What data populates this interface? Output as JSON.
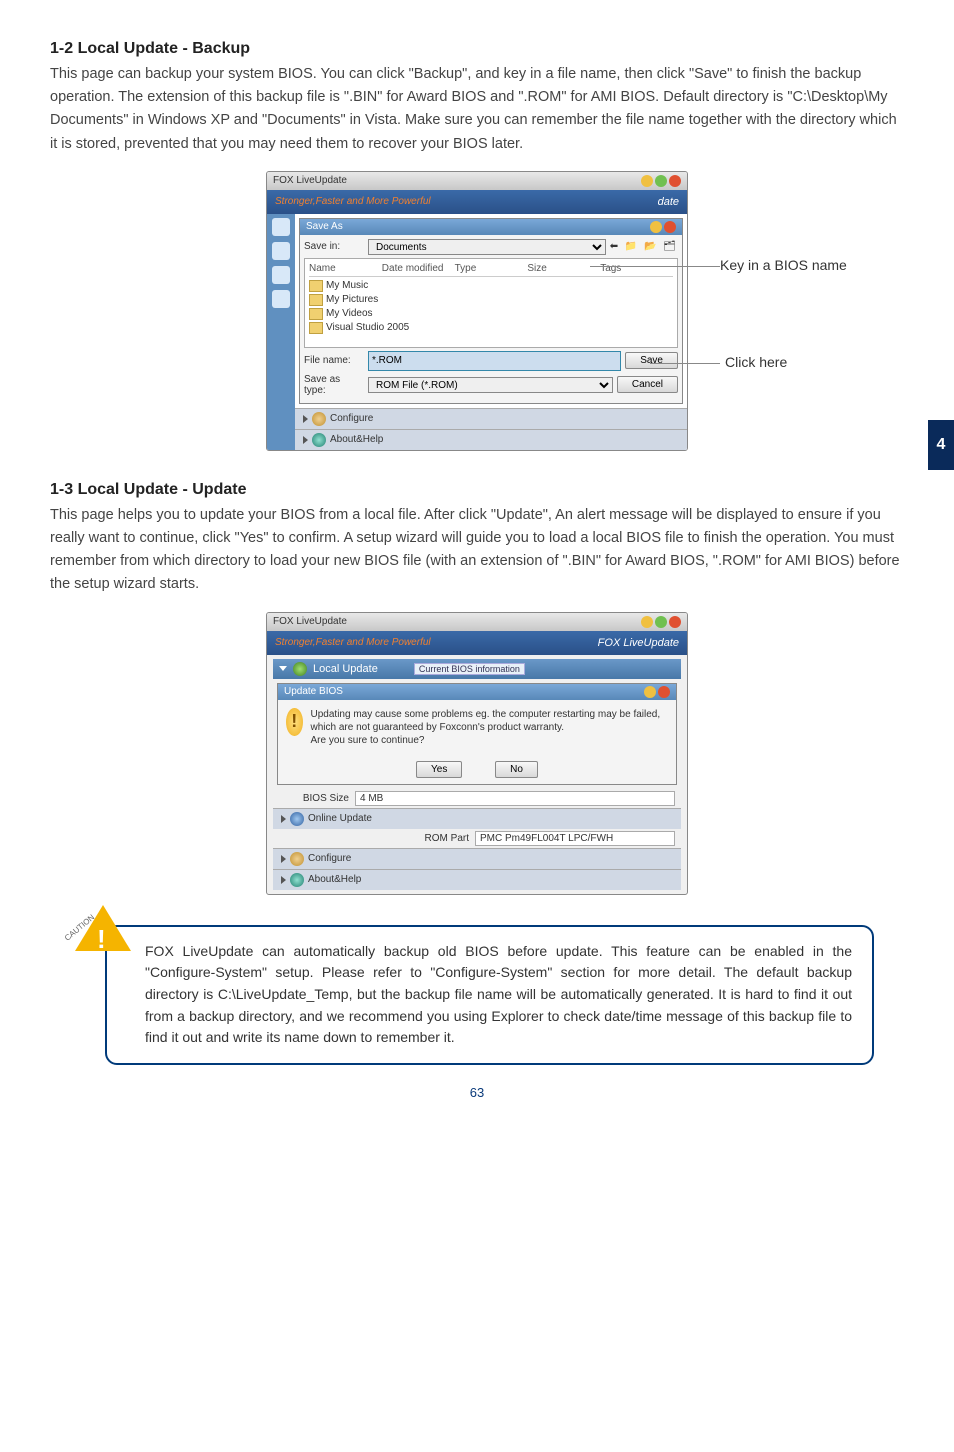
{
  "section12": {
    "heading": "1-2 Local Update - Backup",
    "body": "This page can backup your system BIOS. You can click \"Backup\", and key in a file name, then click \"Save\" to finish the backup operation. The extension of this backup file is \".BIN\" for Award BIOS and \".ROM\" for AMI BIOS. Default directory is \"C:\\Desktop\\My Documents\" in Windows XP and \"Documents\" in Vista. Make sure you can remember the file name together with the directory which it is stored, prevented that you may need them to recover your BIOS later."
  },
  "saveDialog": {
    "appTitle": "FOX LiveUpdate",
    "slogan": "Stronger,Faster and More Powerful",
    "logoPart": "date",
    "dialogTitle": "Save As",
    "saveInLabel": "Save in:",
    "saveInValue": "Documents",
    "cols": {
      "name": "Name",
      "date": "Date modified",
      "type": "Type",
      "size": "Size",
      "tags": "Tags"
    },
    "folders": [
      "My Music",
      "My Pictures",
      "My Videos",
      "Visual Studio 2005"
    ],
    "fileNameLabel": "File name:",
    "fileNameValue": "*.ROM",
    "saveTypeLabel": "Save as type:",
    "saveTypeValue": "ROM File (*.ROM)",
    "saveBtn": "Save",
    "cancelBtn": "Cancel",
    "bottomItems": [
      "Configure",
      "About&Help"
    ],
    "callout1": "Key in a BIOS name",
    "callout2": "Click here"
  },
  "section13": {
    "heading": "1-3 Local Update - Update",
    "body": "This page helps you to update your BIOS from a local file. After click \"Update\", An alert message will be displayed to ensure if you really want to continue, click \"Yes\" to confirm. A setup wizard will guide you to load a local BIOS file to finish the operation. You must remember from which directory to load your new BIOS file (with an extension of \".BIN\" for Award BIOS, \".ROM\" for AMI BIOS) before the setup wizard starts."
  },
  "updateDialog": {
    "appTitle": "FOX LiveUpdate",
    "slogan": "Stronger,Faster and More Powerful",
    "logo": "FOX LiveUpdate",
    "localUpdate": "Local Update",
    "currentInfo": "Current BIOS information",
    "msgTitle": "Update BIOS",
    "msgBody": "Updating may cause some problems eg. the computer restarting may be failed, which are not guaranteed by Foxconn's product warranty.\nAre you sure to continue?",
    "yes": "Yes",
    "no": "No",
    "biosSizeLabel": "BIOS Size",
    "biosSizeValue": "4 MB",
    "romPartLabel": "ROM Part",
    "romPartValue": "PMC Pm49FL004T LPC/FWH",
    "bottomItems": [
      "Online Update",
      "Configure",
      "About&Help"
    ]
  },
  "caution": {
    "label": "CAUTION",
    "text": "FOX LiveUpdate can automatically backup old BIOS before update. This feature can be enabled in the \"Configure-System\" setup. Please refer to \"Configure-System\" section for more detail. The default backup directory is C:\\LiveUpdate_Temp, but the backup file name will be automatically generated. It is hard to find it out from a backup directory, and we recommend you using Explorer to check date/time message of this backup file to find it out and write its name down to remember it."
  },
  "sideTab": "4",
  "pageNumber": "63"
}
